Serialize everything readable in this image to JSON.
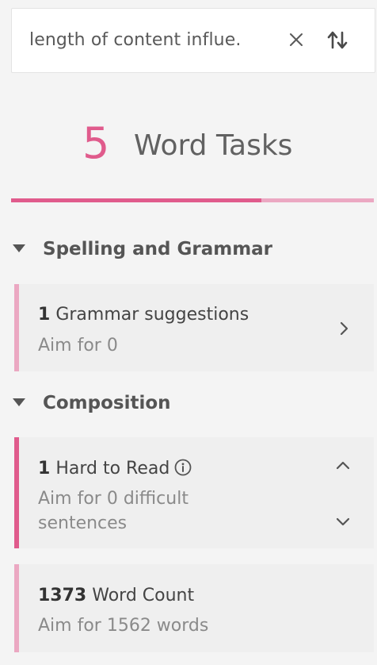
{
  "search": {
    "query": "length of content influe.",
    "clear_icon": "close-icon",
    "swap_icon": "swap-arrows-icon"
  },
  "tasks": {
    "count": "5",
    "label": "Word Tasks",
    "progress_fraction": 0.69
  },
  "colors": {
    "accent": "#e05b8c",
    "accent_light": "#eba8c2"
  },
  "sections": [
    {
      "title": "Spelling and Grammar",
      "cards": [
        {
          "value": "1",
          "label": "Grammar suggestions",
          "aim": "Aim for 0",
          "nav_icon": "chevron-right-icon"
        }
      ]
    },
    {
      "title": "Composition",
      "cards": [
        {
          "value": "1",
          "label": "Hard to Read",
          "aim": "Aim for 0 difficult sentences",
          "info_icon": "info-icon",
          "nav_icons": [
            "chevron-up-icon",
            "chevron-down-icon"
          ]
        },
        {
          "value": "1373",
          "label": "Word Count",
          "aim": "Aim for 1562 words"
        }
      ]
    }
  ]
}
